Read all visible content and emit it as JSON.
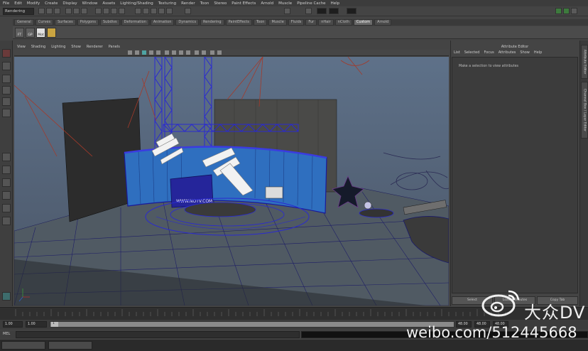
{
  "menubar": {
    "items": [
      "File",
      "Edit",
      "Modify",
      "Create",
      "Display",
      "Window",
      "Assets",
      "Lighting/Shading",
      "Texturing",
      "Render",
      "Toon",
      "Stereo",
      "Paint Effects",
      "Arnold",
      "Muscle",
      "Pipeline Cache",
      "Help"
    ]
  },
  "statusline": {
    "mode": "Rendering"
  },
  "shelf": {
    "tabs": [
      "General",
      "Curves",
      "Surfaces",
      "Polygons",
      "Subdivs",
      "Deformation",
      "Animation",
      "Dynamics",
      "Rendering",
      "PaintEffects",
      "Toon",
      "Muscle",
      "Fluids",
      "Fur",
      "nHair",
      "nCloth",
      "Custom",
      "Arnold"
    ],
    "active_tab": "Custom",
    "buttons": [
      "FT",
      "GP",
      "Mot"
    ]
  },
  "panel": {
    "menu": [
      "View",
      "Shading",
      "Lighting",
      "Show",
      "Renderer",
      "Panels"
    ]
  },
  "viewport": {
    "scene_text": "WWW.NOTV.COM"
  },
  "attribute_editor": {
    "title": "Attribute Editor",
    "menu": [
      "List",
      "Selected",
      "Focus",
      "Attributes",
      "Show",
      "Help"
    ],
    "message": "Make a selection to view attributes",
    "buttons": [
      "Select",
      "Load Attributes",
      "Copy Tab"
    ]
  },
  "sidetabs": [
    "Attribute Editor",
    "Channel Box / Layer Editor"
  ],
  "timeline": {
    "start": "1.00",
    "start2": "1.00",
    "handle_value": "1",
    "end": "48.00",
    "end2": "48.00",
    "end3": "48.00"
  },
  "commandline": {
    "label": "MEL"
  },
  "watermark": {
    "brand": "大众DV",
    "url": "weibo.com/512445668"
  },
  "colors": {
    "viewport_bg": "#5b6c82",
    "grid": "#1a1a6a",
    "selection": "#2a2ad0",
    "ui_bg": "#444444"
  }
}
